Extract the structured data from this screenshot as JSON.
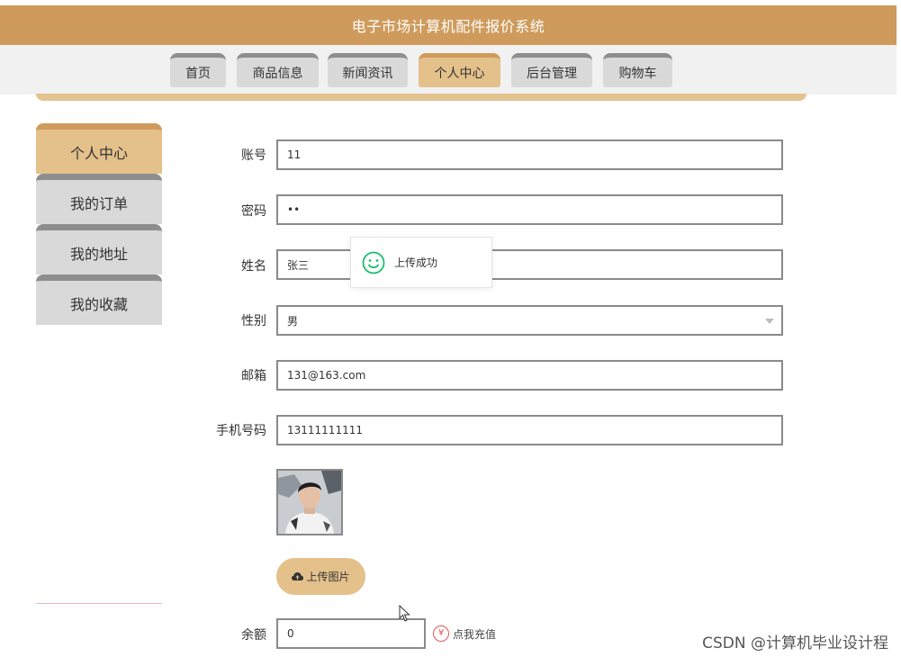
{
  "header": {
    "title": "电子市场计算机配件报价系统"
  },
  "nav": {
    "tabs": [
      {
        "label": "首页"
      },
      {
        "label": "商品信息"
      },
      {
        "label": "新闻资讯"
      },
      {
        "label": "个人中心",
        "active": true
      },
      {
        "label": "后台管理"
      },
      {
        "label": "购物车"
      }
    ]
  },
  "sidebar": {
    "items": [
      {
        "label": "个人中心",
        "active": true
      },
      {
        "label": "我的订单"
      },
      {
        "label": "我的地址"
      },
      {
        "label": "我的收藏"
      }
    ]
  },
  "form": {
    "account": {
      "label": "账号",
      "value": "11"
    },
    "password": {
      "label": "密码",
      "value": "••"
    },
    "name": {
      "label": "姓名",
      "value": "张三"
    },
    "gender": {
      "label": "性别",
      "value": "男"
    },
    "email": {
      "label": "邮箱",
      "value": "131@163.com"
    },
    "phone": {
      "label": "手机号码",
      "value": "13111111111"
    },
    "upload_label": "上传图片",
    "balance": {
      "label": "余额",
      "value": "0"
    },
    "recharge_label": "点我充值"
  },
  "toast": {
    "message": "上传成功",
    "icon": "smile-icon"
  },
  "watermark": "CSDN @计算机毕业设计程",
  "colors": {
    "brand": "#cf9b5c",
    "accent": "#e4c08b",
    "tab_gray": "#d9d9d9",
    "success": "#19be6b",
    "danger": "#e05555"
  }
}
